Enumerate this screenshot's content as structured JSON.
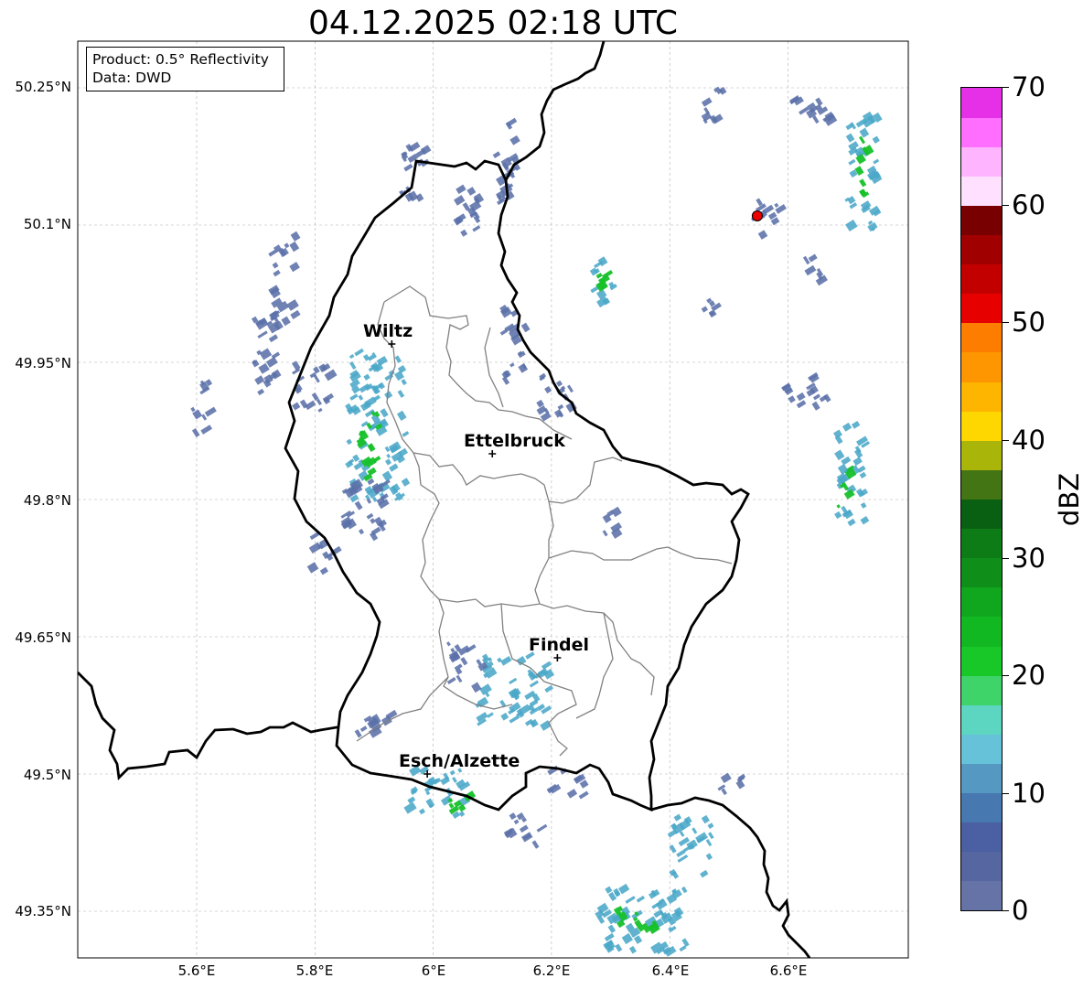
{
  "title": "04.12.2025 02:18 UTC",
  "info_box": {
    "line1": "Product: 0.5° Reflectivity",
    "line2": "Data: DWD"
  },
  "lat_labels": [
    "50.25°N",
    "50.1°N",
    "49.95°N",
    "49.8°N",
    "49.65°N",
    "49.5°N",
    "49.35°N"
  ],
  "lon_labels": [
    "5.6°E",
    "5.8°E",
    "6°E",
    "6.2°E",
    "6.4°E",
    "6.6°E"
  ],
  "cities": [
    {
      "name": "Wiltz",
      "lon": 5.93,
      "lat": 49.97
    },
    {
      "name": "Ettelbruck",
      "lon": 6.1,
      "lat": 49.85
    },
    {
      "name": "Findel",
      "lon": 6.21,
      "lat": 49.627
    },
    {
      "name": "Esch/Alzette",
      "lon": 5.99,
      "lat": 49.5
    }
  ],
  "radar_site": {
    "lon": 6.548,
    "lat": 50.11
  },
  "colorbar": {
    "label": "dBZ",
    "tick_labels": [
      "0",
      "10",
      "20",
      "30",
      "40",
      "50",
      "60",
      "70"
    ],
    "min": 0,
    "max": 70,
    "step": 2.5,
    "colors": [
      "#6673a6",
      "#5566a0",
      "#4a60a3",
      "#4878b0",
      "#5598c2",
      "#66c2d9",
      "#5cd6c0",
      "#3ed46a",
      "#18c828",
      "#12b822",
      "#10a61e",
      "#108e1a",
      "#0e7c16",
      "#0a6012",
      "#437514",
      "#aab50a",
      "#fed700",
      "#fdb500",
      "#fd9600",
      "#fd7d00",
      "#e60000",
      "#c30000",
      "#a00000",
      "#780000",
      "#ffe0ff",
      "#ffb4ff",
      "#ff6eff",
      "#e530e8"
    ]
  },
  "echo_colors": {
    "weak": "#5b71a8",
    "moderate": "#4aa7c8",
    "strong": "#5bd3c4",
    "green": "#16c12a"
  },
  "radar_cells": [
    {
      "lon": 5.9,
      "lat": 49.88,
      "w": 0.1,
      "h": 0.16,
      "level": "moderate"
    },
    {
      "lon": 5.89,
      "lat": 49.86,
      "w": 0.04,
      "h": 0.08,
      "level": "green"
    },
    {
      "lon": 5.79,
      "lat": 49.92,
      "w": 0.06,
      "h": 0.06,
      "level": "weak"
    },
    {
      "lon": 5.71,
      "lat": 49.96,
      "w": 0.04,
      "h": 0.1,
      "level": "weak"
    },
    {
      "lon": 5.88,
      "lat": 49.79,
      "w": 0.09,
      "h": 0.06,
      "level": "weak"
    },
    {
      "lon": 5.81,
      "lat": 49.74,
      "w": 0.05,
      "h": 0.04,
      "level": "weak"
    },
    {
      "lon": 5.74,
      "lat": 50.04,
      "w": 0.04,
      "h": 0.1,
      "level": "weak"
    },
    {
      "lon": 5.6,
      "lat": 49.9,
      "w": 0.03,
      "h": 0.06,
      "level": "weak"
    },
    {
      "lon": 6.13,
      "lat": 49.59,
      "w": 0.12,
      "h": 0.08,
      "level": "moderate"
    },
    {
      "lon": 6.05,
      "lat": 49.62,
      "w": 0.06,
      "h": 0.05,
      "level": "weak"
    },
    {
      "lon": 6.0,
      "lat": 49.48,
      "w": 0.1,
      "h": 0.05,
      "level": "moderate"
    },
    {
      "lon": 6.04,
      "lat": 49.47,
      "w": 0.04,
      "h": 0.02,
      "level": "green"
    },
    {
      "lon": 5.89,
      "lat": 49.55,
      "w": 0.06,
      "h": 0.04,
      "level": "weak"
    },
    {
      "lon": 6.15,
      "lat": 49.44,
      "w": 0.08,
      "h": 0.03,
      "level": "weak"
    },
    {
      "lon": 6.22,
      "lat": 49.49,
      "w": 0.06,
      "h": 0.03,
      "level": "weak"
    },
    {
      "lon": 6.35,
      "lat": 49.34,
      "w": 0.16,
      "h": 0.07,
      "level": "moderate"
    },
    {
      "lon": 6.34,
      "lat": 49.34,
      "w": 0.08,
      "h": 0.03,
      "level": "green"
    },
    {
      "lon": 6.43,
      "lat": 49.42,
      "w": 0.07,
      "h": 0.07,
      "level": "moderate"
    },
    {
      "lon": 6.5,
      "lat": 49.49,
      "w": 0.06,
      "h": 0.02,
      "level": "weak"
    },
    {
      "lon": 6.72,
      "lat": 50.16,
      "w": 0.05,
      "h": 0.13,
      "level": "moderate"
    },
    {
      "lon": 6.72,
      "lat": 50.16,
      "w": 0.02,
      "h": 0.08,
      "level": "green"
    },
    {
      "lon": 6.7,
      "lat": 49.83,
      "w": 0.05,
      "h": 0.11,
      "level": "moderate"
    },
    {
      "lon": 6.69,
      "lat": 49.82,
      "w": 0.02,
      "h": 0.06,
      "level": "green"
    },
    {
      "lon": 6.28,
      "lat": 50.04,
      "w": 0.04,
      "h": 0.05,
      "level": "moderate"
    },
    {
      "lon": 6.28,
      "lat": 50.04,
      "w": 0.015,
      "h": 0.02,
      "level": "green"
    },
    {
      "lon": 6.12,
      "lat": 50.17,
      "w": 0.04,
      "h": 0.1,
      "level": "weak"
    },
    {
      "lon": 6.13,
      "lat": 49.97,
      "w": 0.04,
      "h": 0.08,
      "level": "weak"
    },
    {
      "lon": 6.2,
      "lat": 49.91,
      "w": 0.06,
      "h": 0.05,
      "level": "weak"
    },
    {
      "lon": 6.29,
      "lat": 49.78,
      "w": 0.03,
      "h": 0.04,
      "level": "weak"
    },
    {
      "lon": 5.96,
      "lat": 50.15,
      "w": 0.04,
      "h": 0.08,
      "level": "weak"
    },
    {
      "lon": 6.05,
      "lat": 50.12,
      "w": 0.05,
      "h": 0.06,
      "level": "weak"
    },
    {
      "lon": 6.63,
      "lat": 50.23,
      "w": 0.08,
      "h": 0.03,
      "level": "weak"
    },
    {
      "lon": 6.47,
      "lat": 50.23,
      "w": 0.04,
      "h": 0.04,
      "level": "weak"
    },
    {
      "lon": 6.6,
      "lat": 49.92,
      "w": 0.03,
      "h": 0.04,
      "level": "weak"
    },
    {
      "lon": 6.65,
      "lat": 49.92,
      "w": 0.04,
      "h": 0.04,
      "level": "weak"
    },
    {
      "lon": 6.56,
      "lat": 50.11,
      "w": 0.05,
      "h": 0.04,
      "level": "weak"
    },
    {
      "lon": 6.64,
      "lat": 50.05,
      "w": 0.03,
      "h": 0.04,
      "level": "weak"
    },
    {
      "lon": 6.46,
      "lat": 50.01,
      "w": 0.02,
      "h": 0.02,
      "level": "weak"
    }
  ]
}
